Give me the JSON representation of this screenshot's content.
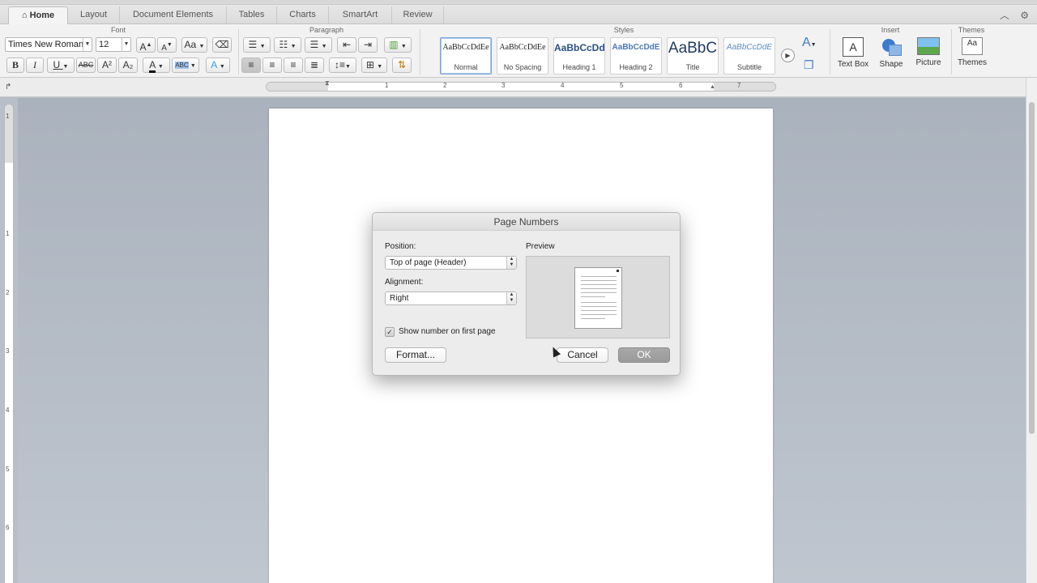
{
  "tabs": [
    {
      "label": "Home",
      "active": true
    },
    {
      "label": "Layout"
    },
    {
      "label": "Document Elements"
    },
    {
      "label": "Tables"
    },
    {
      "label": "Charts"
    },
    {
      "label": "SmartArt"
    },
    {
      "label": "Review"
    }
  ],
  "ribbon": {
    "groups": {
      "font": "Font",
      "paragraph": "Paragraph",
      "styles": "Styles",
      "insert": "Insert",
      "themes": "Themes"
    },
    "font_name": "Times New Roman",
    "font_size": "12",
    "bold": "B",
    "italic": "I",
    "underline": "U",
    "strikethrough": "ABC",
    "superscript": "A²",
    "subscript": "A₂",
    "font_color": "A",
    "highlight": "ABC",
    "grow": "A",
    "shrink": "A",
    "change_case": "Aa",
    "styles": [
      {
        "sample": "AaBbCcDdEe",
        "name": "Normal",
        "selected": true
      },
      {
        "sample": "AaBbCcDdEe",
        "name": "No Spacing"
      },
      {
        "sample": "AaBbCcDd",
        "name": "Heading 1"
      },
      {
        "sample": "AaBbCcDdE",
        "name": "Heading 2"
      },
      {
        "sample": "AaBbC",
        "name": "Title"
      },
      {
        "sample": "AaBbCcDdE",
        "name": "Subtitle"
      }
    ],
    "insert": {
      "text_box": "Text Box",
      "shape": "Shape",
      "picture": "Picture"
    },
    "themes_label": "Themes",
    "themes_sample": "Aa"
  },
  "ruler": {
    "h_numbers": [
      "1",
      "2",
      "3",
      "4",
      "5",
      "6",
      "7"
    ],
    "v_numbers": [
      "1",
      "1",
      "2",
      "3",
      "4",
      "5",
      "6"
    ]
  },
  "dialog": {
    "title": "Page Numbers",
    "position_label": "Position:",
    "position_value": "Top of page (Header)",
    "alignment_label": "Alignment:",
    "alignment_value": "Right",
    "show_first_label": "Show number on first page",
    "show_first_checked": true,
    "preview_label": "Preview",
    "format_button": "Format...",
    "cancel_button": "Cancel",
    "ok_button": "OK"
  }
}
